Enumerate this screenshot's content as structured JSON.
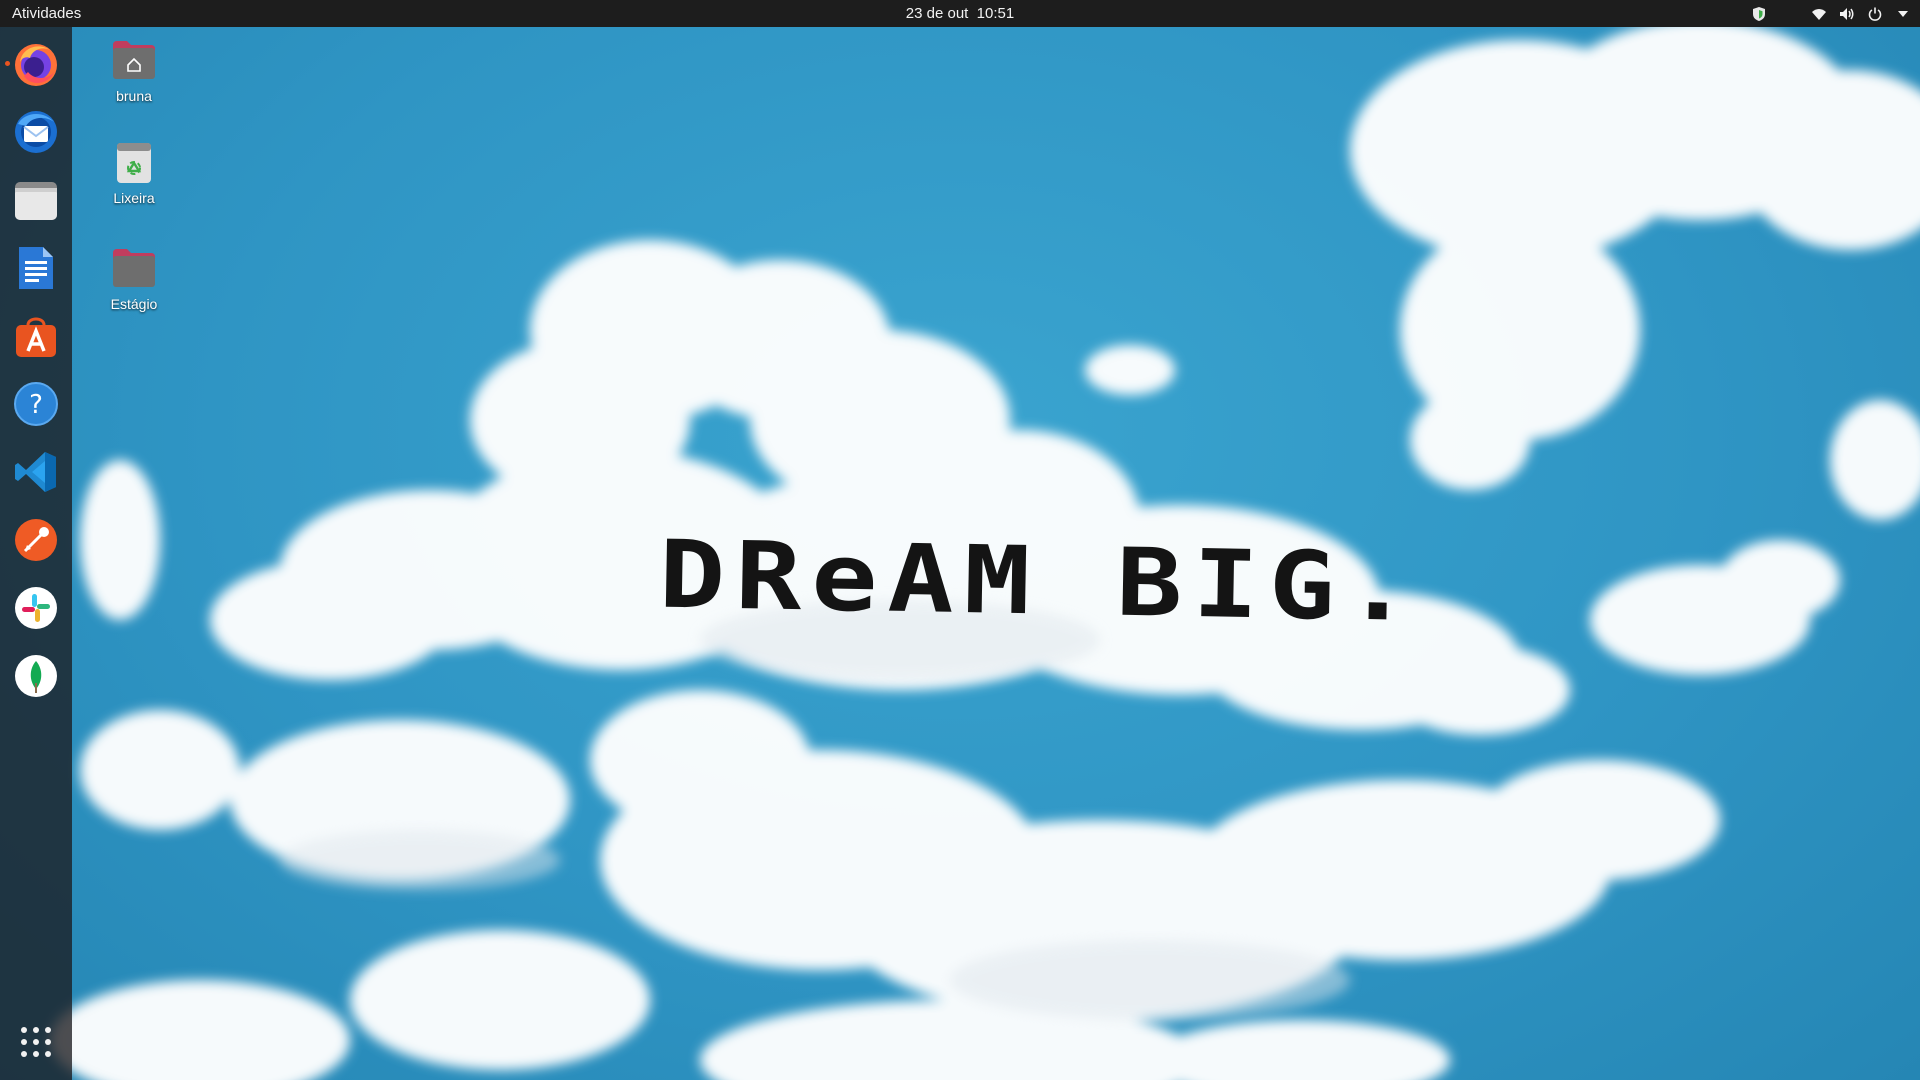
{
  "topbar": {
    "activities_label": "Atividades",
    "clock": "23 de out  10:51",
    "tray_icons": [
      "shield-status-icon",
      "wifi-icon",
      "volume-icon",
      "power-icon",
      "chevron-down-icon"
    ]
  },
  "dock": {
    "items": [
      {
        "name": "Firefox",
        "icon": "firefox-icon",
        "running": true
      },
      {
        "name": "Thunderbird",
        "icon": "thunderbird-icon",
        "running": false
      },
      {
        "name": "Arquivos",
        "icon": "files-icon",
        "running": false
      },
      {
        "name": "LibreOffice Writer",
        "icon": "writer-icon",
        "running": false
      },
      {
        "name": "Ubuntu Software",
        "icon": "software-center-icon",
        "running": false
      },
      {
        "name": "Ajuda",
        "icon": "help-icon",
        "running": false
      },
      {
        "name": "Visual Studio Code",
        "icon": "vscode-icon",
        "running": false
      },
      {
        "name": "Postman",
        "icon": "postman-icon",
        "running": false
      },
      {
        "name": "Slack",
        "icon": "slack-icon",
        "running": false
      },
      {
        "name": "MongoDB Compass",
        "icon": "mongodb-icon",
        "running": false
      }
    ],
    "app_grid_icon": "app-grid-icon"
  },
  "desktop": {
    "icons": [
      {
        "label": "bruna",
        "icon": "home-folder-icon"
      },
      {
        "label": "Lixeira",
        "icon": "trash-icon"
      },
      {
        "label": "Estágio",
        "icon": "folder-icon"
      }
    ]
  },
  "wallpaper": {
    "text": "DReAM BIG.",
    "sky_color": "#2f95c4",
    "cloud_color": "#ffffff"
  },
  "colors": {
    "topbar_bg": "#1d1d1d",
    "dock_bg": "#1c1c20",
    "accent": "#e95420"
  }
}
